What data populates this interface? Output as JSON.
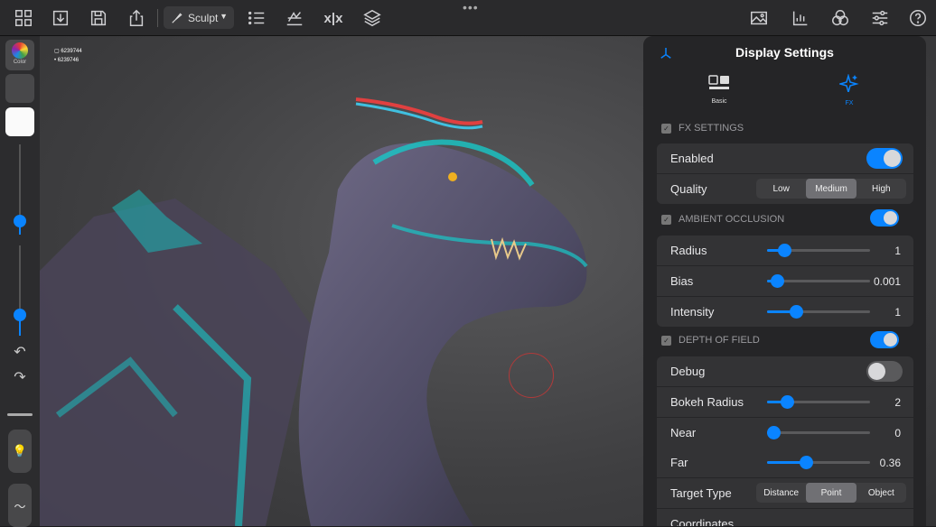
{
  "toolbar": {
    "sculpt_label": "Sculpt",
    "icons": [
      "grid-icon",
      "import-icon",
      "save-icon",
      "share-icon",
      "brush-icon",
      "list-icon",
      "stroke-icon",
      "symmetry-icon",
      "layers-icon",
      "image-icon",
      "stats-icon",
      "display-icon",
      "sliders-icon",
      "help-icon"
    ]
  },
  "sidebar": {
    "color_label": "Color"
  },
  "viewport": {
    "stat_1": "6239744",
    "stat_2": "6239746"
  },
  "panel": {
    "title": "Display Settings",
    "tabs": [
      {
        "label": "Basic",
        "icon": "basic-icon"
      },
      {
        "label": "FX",
        "icon": "sparkle-icon"
      }
    ],
    "fx_settings": {
      "header": "FX SETTINGS",
      "enabled_label": "Enabled",
      "enabled": true,
      "quality_label": "Quality",
      "quality_options": [
        "Low",
        "Medium",
        "High"
      ],
      "quality_selected": "Medium"
    },
    "ambient_occlusion": {
      "header": "AMBIENT OCCLUSION",
      "enabled": true,
      "radius_label": "Radius",
      "radius_value": "1",
      "radius_fraction": 0.17,
      "bias_label": "Bias",
      "bias_value": "0.001",
      "bias_fraction": 0.1,
      "intensity_label": "Intensity",
      "intensity_value": "1",
      "intensity_fraction": 0.28
    },
    "depth_of_field": {
      "header": "DEPTH OF FIELD",
      "enabled": true,
      "debug_label": "Debug",
      "debug": false,
      "bokeh_label": "Bokeh Radius",
      "bokeh_value": "2",
      "bokeh_fraction": 0.19,
      "near_label": "Near",
      "near_value": "0",
      "near_fraction": 0.06,
      "far_label": "Far",
      "far_value": "0.36",
      "far_fraction": 0.38,
      "target_label": "Target Type",
      "target_options": [
        "Distance",
        "Point",
        "Object"
      ],
      "target_selected": "Point",
      "coordinates_label": "Coordinates"
    }
  },
  "colors": {
    "accent": "#0a84ff",
    "panel_bg": "#252527",
    "row_bg": "#333335"
  }
}
